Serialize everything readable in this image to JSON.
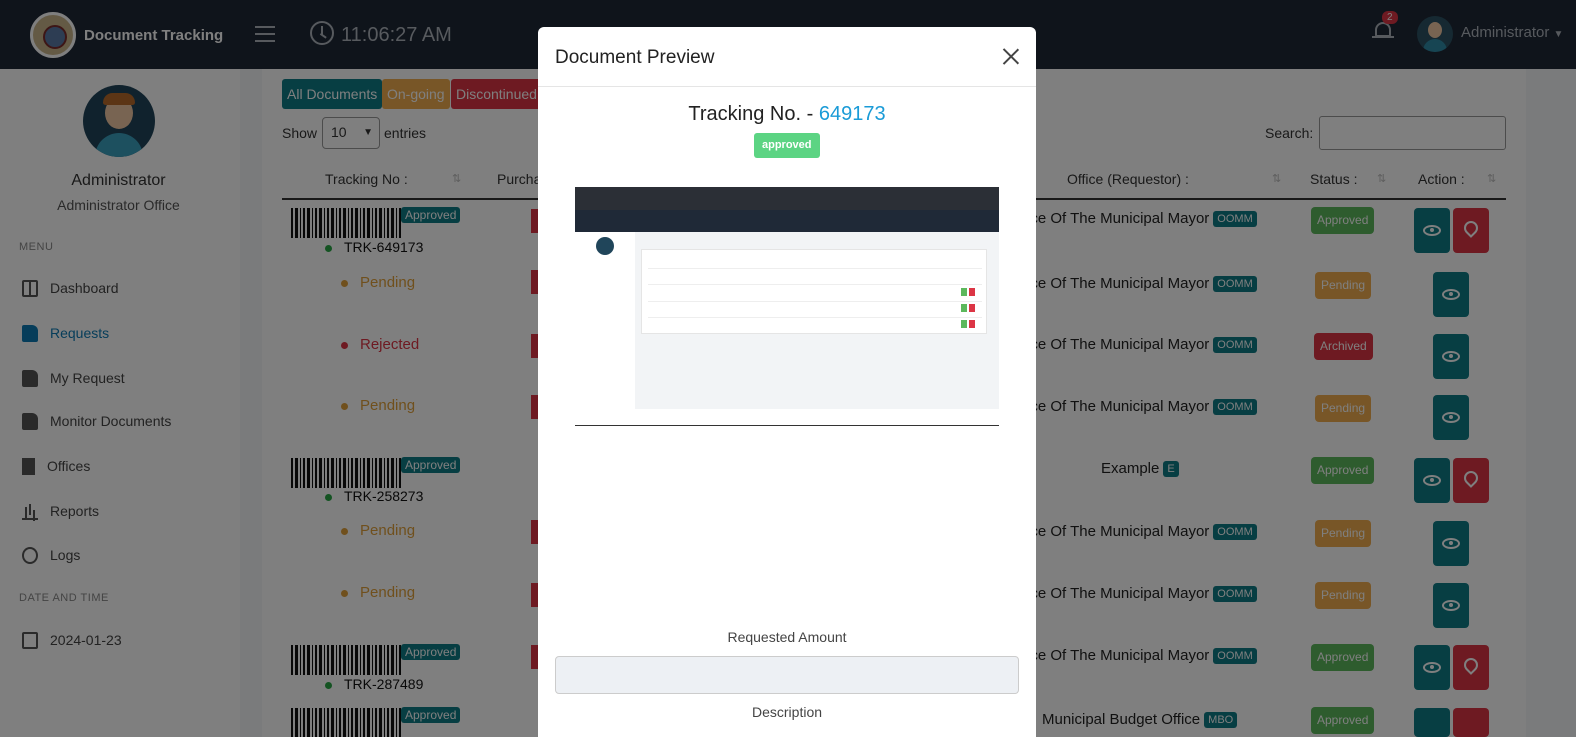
{
  "topbar": {
    "brand": "Document Tracking",
    "time": "11:06:27 AM",
    "notif_count": "2",
    "user": "Administrator"
  },
  "sidebar": {
    "name": "Administrator",
    "office": "Administrator Office",
    "menu_heading": "MENU",
    "items": [
      {
        "label": "Dashboard",
        "icon": "dashboard-icon"
      },
      {
        "label": "Requests",
        "icon": "file-icon",
        "active": true
      },
      {
        "label": "My Request",
        "icon": "file-icon"
      },
      {
        "label": "Monitor Documents",
        "icon": "file-icon"
      },
      {
        "label": "Offices",
        "icon": "building-icon"
      },
      {
        "label": "Reports",
        "icon": "bar-chart-icon"
      },
      {
        "label": "Logs",
        "icon": "history-icon"
      }
    ],
    "date_heading": "DATE AND TIME",
    "date": "2024-01-23"
  },
  "filters": {
    "all": "All Documents",
    "ongoing": "On-going",
    "discontinued": "Discontinued"
  },
  "table_controls": {
    "show": "Show",
    "entries_value": "10",
    "entries": "entries",
    "search_label": "Search:"
  },
  "columns": {
    "tracking": "Tracking No :",
    "purpose": "Purcha",
    "office": "Office (Requestor) :",
    "status": "Status :",
    "action": "Action :"
  },
  "rows": [
    {
      "barcode_badge": "Approved",
      "trk": "TRK-649173",
      "office": "ice Of The Municipal Mayor",
      "tag": "OOMM",
      "status": "Approved"
    },
    {
      "state": "Pending",
      "office": "ice Of The Municipal Mayor",
      "tag": "OOMM",
      "status": "Pending"
    },
    {
      "state": "Rejected",
      "office": "ice Of The Municipal Mayor",
      "tag": "OOMM",
      "status": "Archived"
    },
    {
      "state": "Pending",
      "office": "ice Of The Municipal Mayor",
      "tag": "OOMM",
      "status": "Pending"
    },
    {
      "barcode_badge": "Approved",
      "trk": "TRK-258273",
      "office": "Example",
      "tag": "E",
      "status": "Approved"
    },
    {
      "state": "Pending",
      "office": "ice Of The Municipal Mayor",
      "tag": "OOMM",
      "status": "Pending"
    },
    {
      "state": "Pending",
      "office": "ice Of The Municipal Mayor",
      "tag": "OOMM",
      "status": "Pending"
    },
    {
      "barcode_badge": "Approved",
      "trk": "TRK-287489",
      "office": "ice Of The Municipal Mayor",
      "tag": "OOMM",
      "status": "Approved"
    },
    {
      "barcode_badge": "Approved",
      "office": "Municipal Budget Office",
      "tag": "MBO",
      "status": "Approved"
    }
  ],
  "modal": {
    "title": "Document Preview",
    "tracking_prefix": "Tracking No. - ",
    "tracking_number": "649173",
    "status": "approved",
    "requested_amount_label": "Requested Amount",
    "requested_amount_value": "",
    "description_label": "Description"
  },
  "colors": {
    "teal": "#0e7c86",
    "red": "#dc3545",
    "orange": "#f0ad4e",
    "green": "#5cb85c",
    "navbar": "#1f2937",
    "link_blue": "#1a9bd7"
  }
}
